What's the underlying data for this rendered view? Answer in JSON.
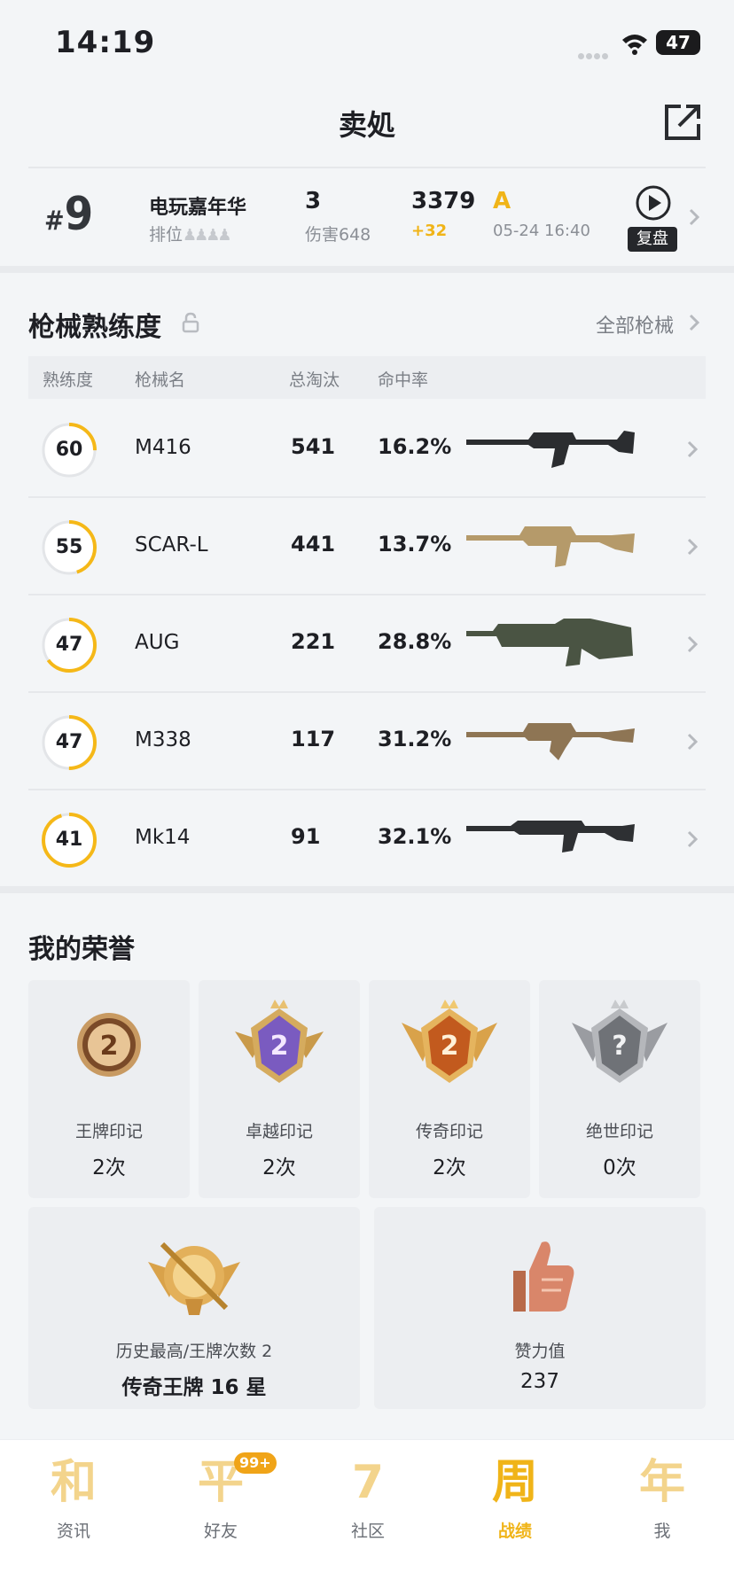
{
  "status": {
    "time": "14:19",
    "battery": "47"
  },
  "header": {
    "title": "卖処"
  },
  "match": {
    "rank_prefix": "#",
    "rank": "9",
    "mode": "电玩嘉年华",
    "mode_sub": "排位",
    "kills": "3",
    "damage": "伤害648",
    "score": "3379",
    "score_delta": "+32",
    "grade": "A",
    "time": "05-24 16:40",
    "replay_label": "复盘"
  },
  "guns": {
    "title": "枪械熟练度",
    "all_label": "全部枪械",
    "headers": {
      "mastery": "熟练度",
      "name": "枪械名",
      "kills": "总淘汰",
      "accuracy": "命中率"
    },
    "rows": [
      {
        "mastery": "60",
        "name": "M416",
        "kills": "541",
        "accuracy": "16.2%",
        "progress": 0.25,
        "gun": "assault-rifle-black"
      },
      {
        "mastery": "55",
        "name": "SCAR-L",
        "kills": "441",
        "accuracy": "13.7%",
        "progress": 0.45,
        "gun": "assault-rifle-tan"
      },
      {
        "mastery": "47",
        "name": "AUG",
        "kills": "221",
        "accuracy": "28.8%",
        "progress": 0.65,
        "gun": "bullpup-rifle-green"
      },
      {
        "mastery": "47",
        "name": "M338",
        "kills": "117",
        "accuracy": "31.2%",
        "progress": 0.5,
        "gun": "machine-gun-bronze"
      },
      {
        "mastery": "41",
        "name": "Mk14",
        "kills": "91",
        "accuracy": "32.1%",
        "progress": 0.95,
        "gun": "marksman-rifle-black"
      }
    ],
    "accent_color": "#f5b818"
  },
  "honors": {
    "title": "我的荣誉",
    "items": [
      {
        "name": "王牌印记",
        "count": "2次",
        "badge": "ace-badge",
        "level": "2"
      },
      {
        "name": "卓越印记",
        "count": "2次",
        "badge": "excellence-badge",
        "level": "2"
      },
      {
        "name": "传奇印记",
        "count": "2次",
        "badge": "legend-badge",
        "level": "2"
      },
      {
        "name": "绝世印记",
        "count": "0次",
        "badge": "peerless-badge",
        "level": "?"
      }
    ],
    "best": {
      "sub": "历史最高/王牌次数 2",
      "main": "传奇王牌 16 星",
      "badge": "legend-ace-badge"
    },
    "likes": {
      "sub": "赞力值",
      "main": "237",
      "badge": "thumbs-up-badge"
    }
  },
  "tabs": [
    {
      "icon_char": "和",
      "label": "资讯"
    },
    {
      "icon_char": "平",
      "label": "好友",
      "badge": "99+"
    },
    {
      "icon_char": "7",
      "label": "社区"
    },
    {
      "icon_char": "周",
      "label": "战绩",
      "active": true
    },
    {
      "icon_char": "年",
      "label": "我"
    }
  ]
}
